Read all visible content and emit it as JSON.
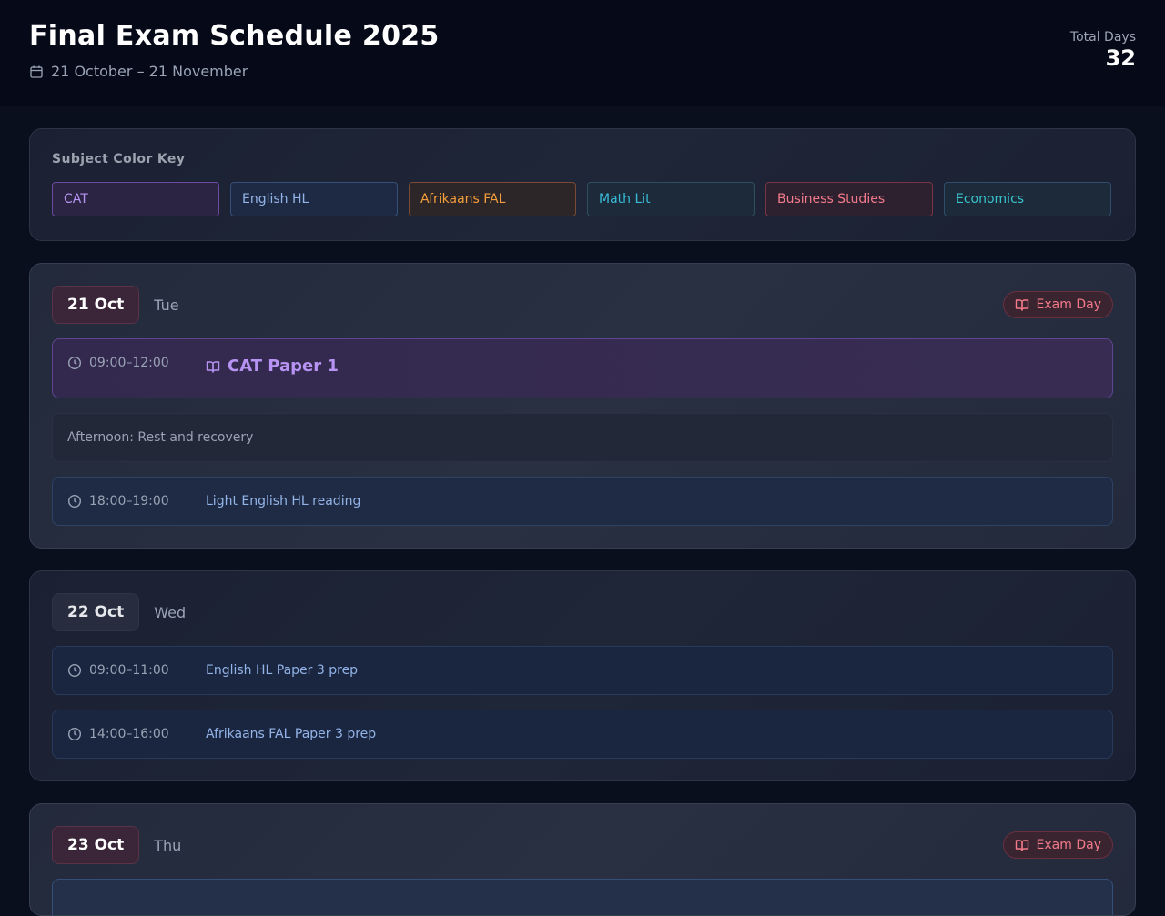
{
  "header": {
    "title": "Final Exam Schedule 2025",
    "date_range": "21 October – 21 November",
    "total_label": "Total Days",
    "total_value": "32"
  },
  "color_key": {
    "title": "Subject Color Key",
    "subjects": [
      {
        "label": "CAT",
        "color": "#b794f4"
      },
      {
        "label": "English HL",
        "color": "#93b4e8"
      },
      {
        "label": "Afrikaans FAL",
        "color": "#f59e3b"
      },
      {
        "label": "Math Lit",
        "color": "#38bdd8"
      },
      {
        "label": "Business Studies",
        "color": "#f47a8a"
      },
      {
        "label": "Economics",
        "color": "#38c4cc"
      }
    ]
  },
  "days": [
    {
      "date": "21 Oct",
      "weekday": "Tue",
      "badge": "Exam Day",
      "exam": {
        "time": "09:00–12:00",
        "title": "CAT Paper 1"
      },
      "rest": "Afternoon: Rest and recovery",
      "study": {
        "time": "18:00–19:00",
        "title": "Light English HL reading"
      }
    },
    {
      "date": "22 Oct",
      "weekday": "Wed",
      "slots": [
        {
          "time": "09:00–11:00",
          "title": "English HL Paper 3 prep"
        },
        {
          "time": "14:00–16:00",
          "title": "Afrikaans FAL Paper 3 prep"
        }
      ]
    },
    {
      "date": "23 Oct",
      "weekday": "Thu",
      "badge": "Exam Day"
    }
  ],
  "colors": {
    "background": "#0a0f1e",
    "exam_accent": "#f47a8a",
    "cat_accent": "#b794f4"
  }
}
